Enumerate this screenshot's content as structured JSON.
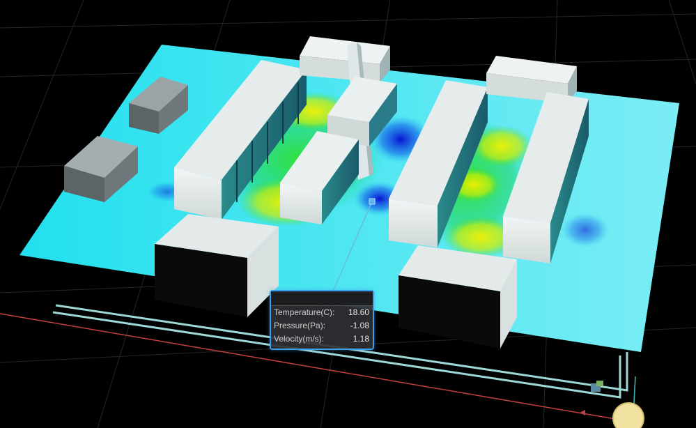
{
  "probe": {
    "rows": [
      {
        "label": "Temperature(C):",
        "value": "18.60"
      },
      {
        "label": "Pressure(Pa):",
        "value": "-1.08"
      },
      {
        "label": "Velocity(m/s):",
        "value": "1.18"
      }
    ]
  },
  "colors": {
    "background": "#000000",
    "grid": "#2a2a2a",
    "floor_base": "#22e0ee",
    "hot_yellow": "#eef000",
    "warm_green": "#28dc28",
    "cold_blue": "#1020d8",
    "building": "#e8eeee",
    "tooltip_border": "#3aa0e8",
    "axis_x": "#c44040",
    "axis_y": "#40c0c0"
  }
}
